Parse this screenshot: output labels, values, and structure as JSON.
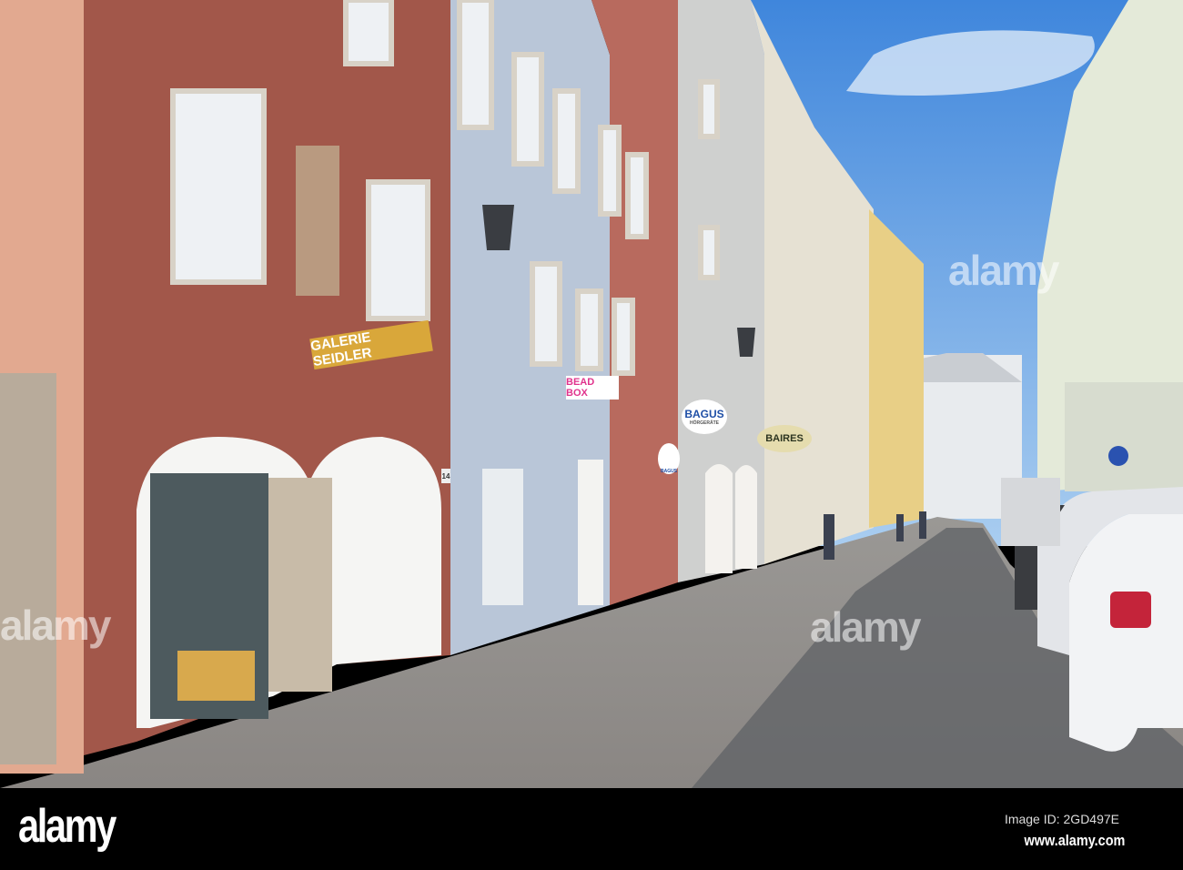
{
  "signs": {
    "galerie": "GALERIE SEIDLER",
    "beadbox": "BEAD BOX",
    "bagus": "BAGUS",
    "bagus_sub": "HÖRGERÄTE",
    "bagus_small": "BAGUS",
    "baires": "BAIRES",
    "house_number": "14"
  },
  "watermark": {
    "logo": "alamy",
    "overlay1": "alamy",
    "overlay2": "alamy",
    "overlay3": "alamy"
  },
  "footer": {
    "image_id": "Image ID: 2GD497E",
    "url": "www.alamy.com"
  },
  "colors": {
    "sky": "#4f93e0",
    "brown_facade": "#a2574a",
    "blue_facade": "#b9c6d8",
    "pavement": "#8f8a86"
  }
}
